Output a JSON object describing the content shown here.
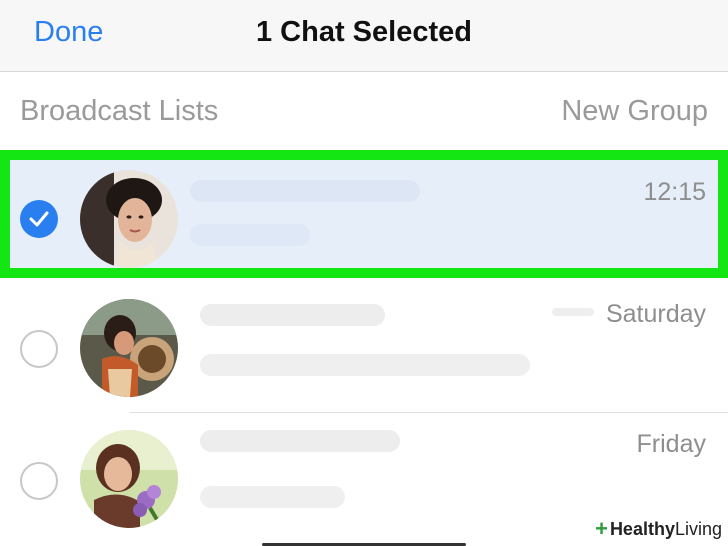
{
  "nav": {
    "done_label": "Done",
    "title": "1 Chat Selected"
  },
  "links": {
    "broadcast_label": "Broadcast Lists",
    "new_group_label": "New Group"
  },
  "chats": [
    {
      "time": "12:15",
      "selected": true
    },
    {
      "time": "Saturday",
      "selected": false
    },
    {
      "time": "Friday",
      "selected": false
    }
  ],
  "watermark": {
    "mark": "+",
    "bold": "Healthy",
    "light": " Living"
  },
  "colors": {
    "accent": "#2a7ff0",
    "selection_outline": "#14e614",
    "selected_row_bg": "#e6eefa"
  }
}
